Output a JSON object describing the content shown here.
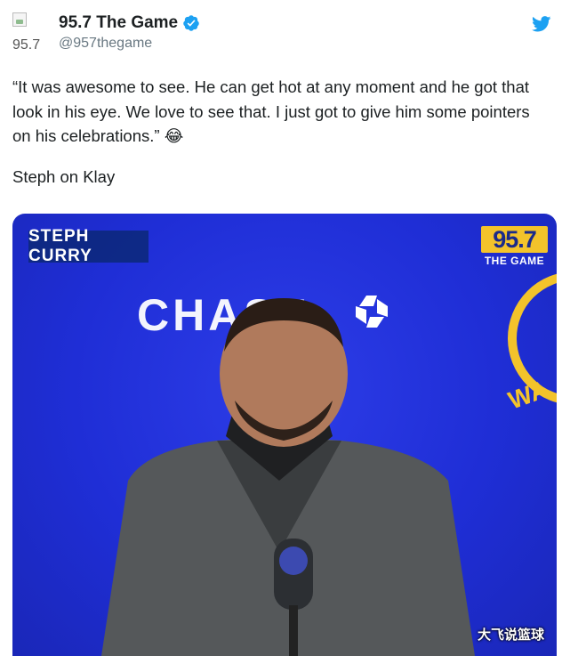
{
  "account": {
    "display_name": "95.7 The Game",
    "avatar_alt": "95.7",
    "handle": "@957thegame"
  },
  "tweet": {
    "text": "“It was awesome to see. He can get hot at any moment and he got that look in his eye. We love to see that. I just got to give him some pointers on his celebrations.” 😂",
    "subtext": "Steph on Klay"
  },
  "media": {
    "name_chip": "STEPH CURRY",
    "station_number": "95.7",
    "station_name": "THE GAME",
    "sponsor_text": "CHASE",
    "watermark": "大飞说篮球"
  },
  "colors": {
    "twitter_blue": "#1da1f2",
    "backdrop_blue": "#1f2ed6",
    "station_yellow": "#f3c32b"
  },
  "icons": [
    "broken-image-icon",
    "verified-badge-icon",
    "twitter-bird-icon",
    "chase-octagon-logo"
  ]
}
